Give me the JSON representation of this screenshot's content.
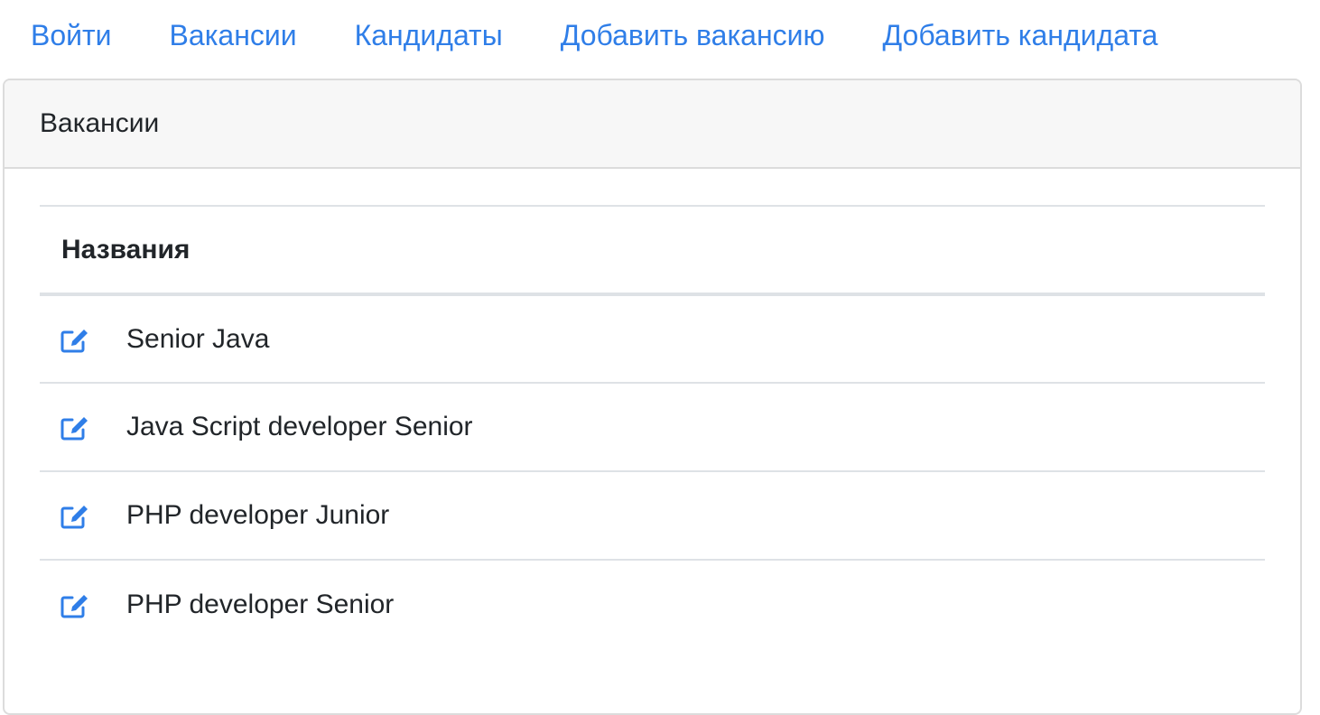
{
  "nav": {
    "items": [
      {
        "label": "Войти"
      },
      {
        "label": "Вакансии"
      },
      {
        "label": "Кандидаты"
      },
      {
        "label": "Добавить вакансию"
      },
      {
        "label": "Добавить кандидата"
      }
    ]
  },
  "card": {
    "header": "Вакансии",
    "table": {
      "column_header": "Названия",
      "rows": [
        {
          "name": "Senior Java",
          "icon": "edit-icon"
        },
        {
          "name": "Java Script developer Senior",
          "icon": "edit-icon"
        },
        {
          "name": "PHP developer Junior",
          "icon": "edit-icon"
        },
        {
          "name": "PHP developer Senior",
          "icon": "edit-icon"
        }
      ]
    }
  },
  "colors": {
    "link": "#2f7ee8",
    "text": "#212529",
    "header_bg": "#f7f7f7",
    "border": "#dee2e6"
  }
}
